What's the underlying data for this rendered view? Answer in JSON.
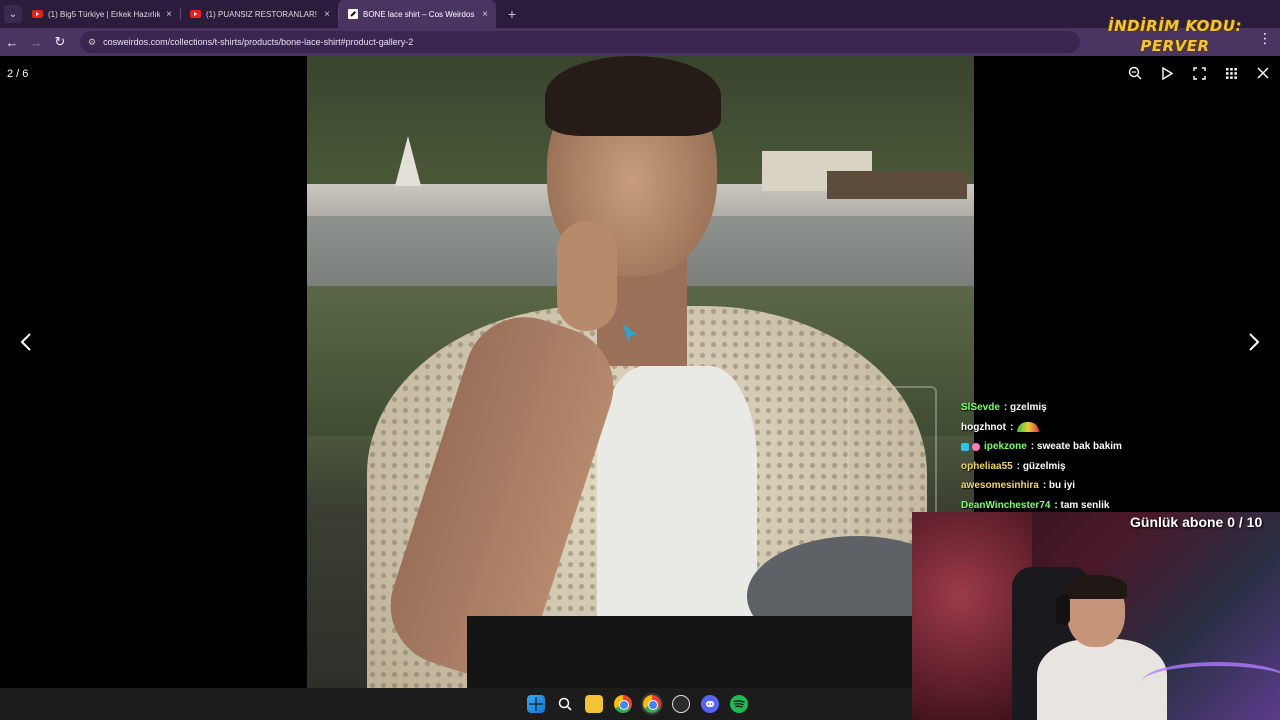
{
  "browser": {
    "tabs": [
      {
        "title": "(1) Big5 Türkiye | Erkek Hazırlık",
        "favicon": "youtube-icon",
        "active": false
      },
      {
        "title": "(1) PUANSIZ RESTORANLAR! El",
        "favicon": "youtube-icon",
        "active": false
      },
      {
        "title": "BONE lace shirt – Cos Weirdos",
        "favicon": "cosweirdos-icon",
        "active": true
      }
    ],
    "tab_close_glyph": "×",
    "new_tab_glyph": "+",
    "url": "cosweirdos.com/collections/t-shirts/products/bone-lace-shirt#product-gallery-2"
  },
  "overlay": {
    "promo_line1": "İNDİRİM KODU:",
    "promo_line2": "PERVER"
  },
  "gallery": {
    "counter": "2 / 6",
    "tools": [
      "zoom-out-icon",
      "play-icon",
      "fullscreen-icon",
      "grid-icon",
      "close-icon"
    ]
  },
  "chat": {
    "messages": [
      {
        "user": "SlSevde",
        "user_color": "#7cff6b",
        "text": "gzelmiş"
      },
      {
        "user": "hogzhnot",
        "user_color": "#ffffff",
        "text": "",
        "emote": true
      },
      {
        "user": "ipekzone",
        "user_color": "#7cff6b",
        "text": "sweate bak bakim",
        "badges": true
      },
      {
        "user": "opheliaa55",
        "user_color": "#f2d56b",
        "text": "güzelmiş"
      },
      {
        "user": "awesomesinhira",
        "user_color": "#f2d56b",
        "text": "bu iyi"
      },
      {
        "user": "DeanWinchester74",
        "user_color": "#7cff6b",
        "text": "tam senlik"
      }
    ]
  },
  "stream": {
    "sub_goal": "Günlük abone 0 / 10"
  },
  "taskbar": {
    "icons": [
      "windows-start-icon",
      "search-icon",
      "file-explorer-icon",
      "chrome-icon",
      "chrome-active-icon",
      "obs-icon",
      "discord-icon",
      "spotify-icon"
    ]
  }
}
